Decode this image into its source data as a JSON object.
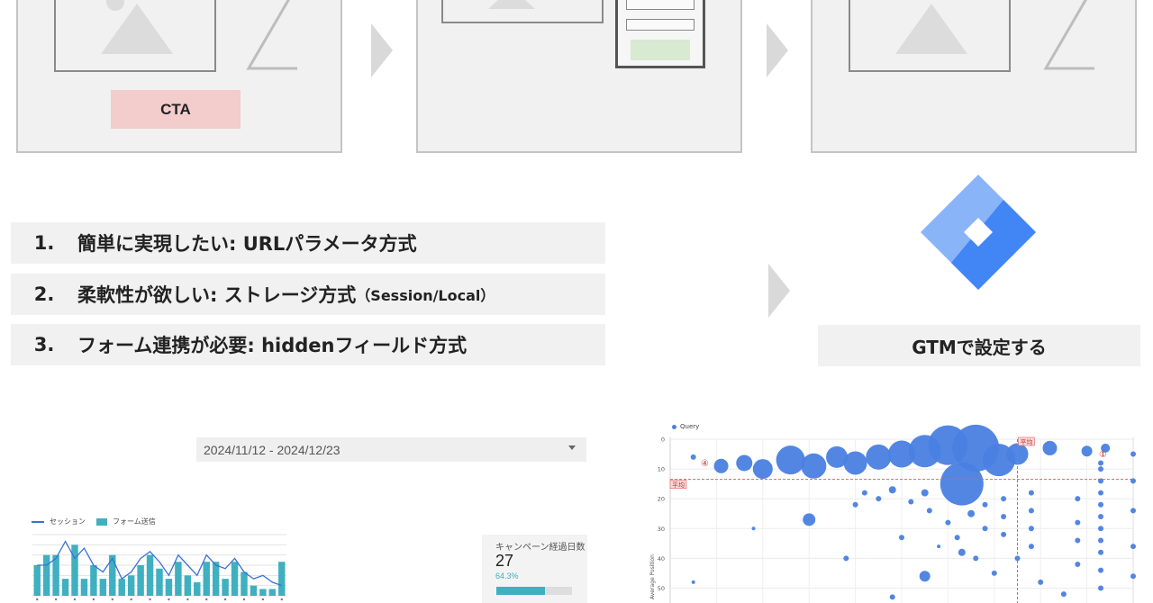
{
  "flow": {
    "cta_label": "CTA",
    "methods": [
      {
        "num": "1.",
        "text": "簡単に実現したい: URLパラメータ方式",
        "paren": ""
      },
      {
        "num": "2.",
        "text": "柔軟性が欲しい: ストレージ方式",
        "paren": "（Session/Local）"
      },
      {
        "num": "3.",
        "text": "フォーム連携が必要: hiddenフィールド方式",
        "paren": ""
      }
    ],
    "gtm_label": "GTMで設定する"
  },
  "colors": {
    "cta_bg": "#f3cccc",
    "form_submit_bg": "#d8ead2",
    "gtm_light": "#8ab4f8",
    "gtm_dark": "#4285f4",
    "bar": "#3fb0c0",
    "line": "#3a72d6",
    "bubble": "#4a80e0",
    "guide": "#e06060"
  },
  "dashboard": {
    "date_range": "2024/11/12 - 2024/12/23",
    "legend": {
      "session": "セッション",
      "form": "フォーム送信"
    },
    "kpi": {
      "label": "キャンペーン経過日数",
      "value": "27",
      "percent": "64.3%",
      "progress": 0.643
    },
    "chart_data": {
      "type": "bar",
      "series": [
        {
          "name": "フォーム送信",
          "type": "bar",
          "values": [
            9,
            12,
            12,
            5,
            15,
            5,
            9,
            5,
            12,
            5,
            6,
            9,
            12,
            8,
            5,
            10,
            6,
            4,
            10,
            10,
            5,
            10,
            7,
            3,
            2,
            2,
            10
          ]
        },
        {
          "name": "セッション",
          "type": "line",
          "values": [
            9,
            9,
            11,
            16,
            11,
            14,
            9,
            7,
            11,
            5,
            7,
            11,
            13,
            10,
            6,
            12,
            9,
            6,
            12,
            9,
            8,
            11,
            7,
            5,
            6,
            4,
            3
          ]
        }
      ],
      "ylim": [
        0,
        18
      ],
      "grid": true
    }
  },
  "scatter": {
    "legend": "Query",
    "ylabel": "Average Position",
    "avg_label": "平均",
    "quadrant_4": "④",
    "quadrant_1": "①",
    "yticks": [
      "0",
      "10",
      "20",
      "30",
      "40",
      "50"
    ],
    "chart_data": {
      "type": "scatter",
      "ylim": [
        0,
        55
      ],
      "x_avg": 0.75,
      "y_avg": 13.5,
      "points": [
        [
          0.05,
          6,
          3
        ],
        [
          0.11,
          9,
          8
        ],
        [
          0.16,
          8,
          9
        ],
        [
          0.2,
          10,
          11
        ],
        [
          0.26,
          7,
          16
        ],
        [
          0.31,
          9,
          14
        ],
        [
          0.36,
          6,
          12
        ],
        [
          0.4,
          8,
          13
        ],
        [
          0.45,
          6,
          14
        ],
        [
          0.5,
          5,
          15
        ],
        [
          0.55,
          4,
          18
        ],
        [
          0.6,
          2,
          22
        ],
        [
          0.66,
          3,
          26
        ],
        [
          0.71,
          7,
          18
        ],
        [
          0.75,
          5,
          12
        ],
        [
          0.82,
          3,
          8
        ],
        [
          0.9,
          4,
          6
        ],
        [
          0.94,
          3,
          5
        ],
        [
          0.63,
          15,
          24
        ],
        [
          0.55,
          18,
          4
        ],
        [
          0.45,
          20,
          3
        ],
        [
          0.3,
          27,
          7
        ],
        [
          0.18,
          30,
          2
        ],
        [
          0.5,
          33,
          3
        ],
        [
          0.58,
          36,
          2
        ],
        [
          0.63,
          38,
          4
        ],
        [
          0.55,
          46,
          6
        ],
        [
          0.7,
          45,
          3
        ],
        [
          0.48,
          53,
          3
        ],
        [
          0.05,
          48,
          2
        ],
        [
          0.93,
          8,
          3
        ],
        [
          0.93,
          10,
          3
        ],
        [
          0.93,
          14,
          3
        ],
        [
          0.93,
          18,
          3
        ],
        [
          0.93,
          22,
          3
        ],
        [
          0.93,
          26,
          3
        ],
        [
          0.93,
          30,
          3
        ],
        [
          0.93,
          34,
          3
        ],
        [
          0.93,
          38,
          3
        ],
        [
          0.93,
          44,
          3
        ],
        [
          0.93,
          50,
          3
        ],
        [
          0.88,
          20,
          3
        ],
        [
          0.88,
          28,
          3
        ],
        [
          0.88,
          34,
          3
        ],
        [
          0.88,
          42,
          3
        ],
        [
          0.78,
          18,
          3
        ],
        [
          0.78,
          24,
          3
        ],
        [
          0.78,
          30,
          3
        ],
        [
          0.78,
          36,
          3
        ],
        [
          0.72,
          20,
          3
        ],
        [
          0.72,
          26,
          3
        ],
        [
          0.72,
          32,
          3
        ],
        [
          0.68,
          22,
          3
        ],
        [
          0.68,
          30,
          3
        ],
        [
          0.66,
          40,
          3
        ],
        [
          0.65,
          25,
          4
        ],
        [
          0.6,
          28,
          3
        ],
        [
          0.62,
          33,
          3
        ],
        [
          0.75,
          40,
          3
        ],
        [
          0.8,
          48,
          3
        ],
        [
          0.85,
          52,
          3
        ],
        [
          0.42,
          18,
          3
        ],
        [
          0.4,
          22,
          3
        ],
        [
          0.48,
          17,
          4
        ],
        [
          0.52,
          21,
          3
        ],
        [
          0.56,
          24,
          3
        ],
        [
          0.38,
          40,
          3
        ],
        [
          1.0,
          5,
          3
        ],
        [
          1.0,
          14,
          3
        ],
        [
          1.0,
          24,
          3
        ],
        [
          1.0,
          36,
          3
        ],
        [
          1.0,
          46,
          3
        ]
      ]
    }
  }
}
